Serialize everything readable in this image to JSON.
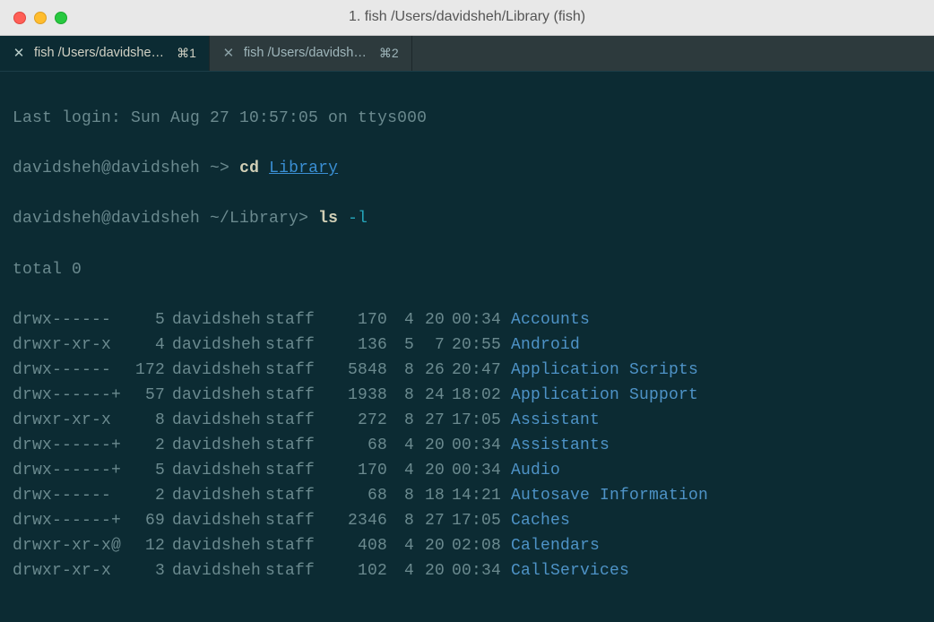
{
  "window": {
    "title": "1. fish  /Users/davidsheh/Library (fish)"
  },
  "tabs": [
    {
      "label": "fish  /Users/davidshe…",
      "shortcut": "⌘1",
      "active": true
    },
    {
      "label": "fish  /Users/davidsh…",
      "shortcut": "⌘2",
      "active": false
    }
  ],
  "session": {
    "last_login": "Last login: Sun Aug 27 10:57:05 on ttys000",
    "prompt1_userhost": "davidsheh@davidsheh",
    "prompt1_path": " ~> ",
    "cmd1": "cd ",
    "cmd1_arg": "Library",
    "prompt2_userhost": "davidsheh@davidsheh",
    "prompt2_path": " ~/Library> ",
    "cmd2": "ls ",
    "cmd2_arg": "-l",
    "total_line": "total 0"
  },
  "listing": [
    {
      "perm": "drwx------",
      "links": "5",
      "user": "davidsheh",
      "group": "staff",
      "size": "170",
      "m": "4",
      "d": "20",
      "time": "00:34",
      "name": "Accounts"
    },
    {
      "perm": "drwxr-xr-x",
      "links": "4",
      "user": "davidsheh",
      "group": "staff",
      "size": "136",
      "m": "5",
      "d": "7",
      "time": "20:55",
      "name": "Android"
    },
    {
      "perm": "drwx------",
      "links": "172",
      "user": "davidsheh",
      "group": "staff",
      "size": "5848",
      "m": "8",
      "d": "26",
      "time": "20:47",
      "name": "Application Scripts"
    },
    {
      "perm": "drwx------+",
      "links": "57",
      "user": "davidsheh",
      "group": "staff",
      "size": "1938",
      "m": "8",
      "d": "24",
      "time": "18:02",
      "name": "Application Support"
    },
    {
      "perm": "drwxr-xr-x",
      "links": "8",
      "user": "davidsheh",
      "group": "staff",
      "size": "272",
      "m": "8",
      "d": "27",
      "time": "17:05",
      "name": "Assistant"
    },
    {
      "perm": "drwx------+",
      "links": "2",
      "user": "davidsheh",
      "group": "staff",
      "size": "68",
      "m": "4",
      "d": "20",
      "time": "00:34",
      "name": "Assistants"
    },
    {
      "perm": "drwx------+",
      "links": "5",
      "user": "davidsheh",
      "group": "staff",
      "size": "170",
      "m": "4",
      "d": "20",
      "time": "00:34",
      "name": "Audio"
    },
    {
      "perm": "drwx------",
      "links": "2",
      "user": "davidsheh",
      "group": "staff",
      "size": "68",
      "m": "8",
      "d": "18",
      "time": "14:21",
      "name": "Autosave Information"
    },
    {
      "perm": "drwx------+",
      "links": "69",
      "user": "davidsheh",
      "group": "staff",
      "size": "2346",
      "m": "8",
      "d": "27",
      "time": "17:05",
      "name": "Caches"
    },
    {
      "perm": "drwxr-xr-x@",
      "links": "12",
      "user": "davidsheh",
      "group": "staff",
      "size": "408",
      "m": "4",
      "d": "20",
      "time": "02:08",
      "name": "Calendars"
    },
    {
      "perm": "drwxr-xr-x",
      "links": "3",
      "user": "davidsheh",
      "group": "staff",
      "size": "102",
      "m": "4",
      "d": "20",
      "time": "00:34",
      "name": "CallServices"
    }
  ],
  "colors": {
    "bg": "#0c2b33",
    "text_muted": "#6b8a8f",
    "text_bright": "#d1cfb6",
    "dir": "#4e93c7",
    "args": "#25a5ba",
    "link": "#3a8fd4"
  }
}
